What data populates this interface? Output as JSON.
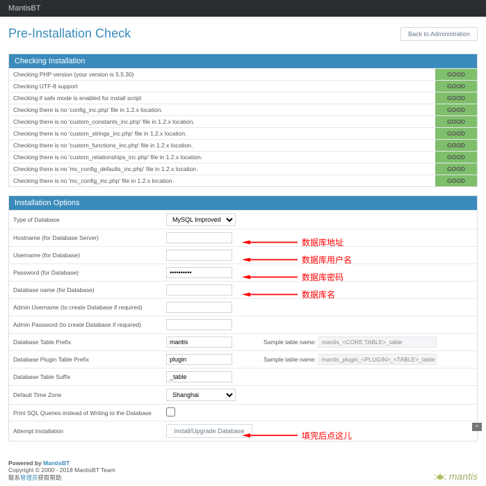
{
  "topbar": {
    "brand": "MantisBT"
  },
  "header": {
    "title": "Pre-Installation Check",
    "back_btn": "Back to Administration"
  },
  "check": {
    "heading": "Checking Installation",
    "rows": [
      {
        "label": "Checking PHP version (your version is 5.5.30)",
        "status": "GOOD"
      },
      {
        "label": "Checking UTF-8 support",
        "status": "GOOD"
      },
      {
        "label": "Checking if safe mode is enabled for install script",
        "status": "GOOD"
      },
      {
        "label": "Checking there is no 'config_inc.php' file in 1.2.x location.",
        "status": "GOOD"
      },
      {
        "label": "Checking there is no 'custom_constants_inc.php' file in 1.2.x location.",
        "status": "GOOD"
      },
      {
        "label": "Checking there is no 'custom_strings_inc.php' file in 1.2.x location.",
        "status": "GOOD"
      },
      {
        "label": "Checking there is no 'custom_functions_inc.php' file in 1.2.x location.",
        "status": "GOOD"
      },
      {
        "label": "Checking there is no 'custom_relationships_inc.php' file in 1.2.x location.",
        "status": "GOOD"
      },
      {
        "label": "Checking there is no 'mc_config_defaults_inc.php' file in 1.2.x location.",
        "status": "GOOD"
      },
      {
        "label": "Checking there is no 'mc_config_inc.php' file in 1.2.x location.",
        "status": "GOOD"
      }
    ]
  },
  "options": {
    "heading": "Installation Options",
    "db_type": {
      "label": "Type of Database",
      "value": "MySQL Improved"
    },
    "hostname": {
      "label": "Hostname (for Database Server)",
      "value": ""
    },
    "username": {
      "label": "Username (for Database)",
      "value": ""
    },
    "password": {
      "label": "Password (for Database)",
      "value": "••••••••••"
    },
    "dbname": {
      "label": "Database name (for Database)",
      "value": ""
    },
    "admin_user": {
      "label": "Admin Username (to create Database if required)",
      "value": ""
    },
    "admin_pass": {
      "label": "Admin Password (to create Database if required)",
      "value": ""
    },
    "prefix": {
      "label": "Database Table Prefix",
      "value": "mantis",
      "sample_label": "Sample table name:",
      "sample": "mantis_<CORE TABLE>_table"
    },
    "plugin_prefix": {
      "label": "Database Plugin Table Prefix",
      "value": "plugin",
      "sample_label": "Sample table name:",
      "sample": "mantis_plugin_<PLUGIN>_<TABLE>_table"
    },
    "suffix": {
      "label": "Database Table Suffix",
      "value": "_table"
    },
    "timezone": {
      "label": "Default Time Zone",
      "value": "Shanghai"
    },
    "print_sql": {
      "label": "Print SQL Queries instead of Writing to the Database"
    },
    "attempt": {
      "label": "Attempt Installation",
      "button": "Install/Upgrade Database"
    }
  },
  "annotations": {
    "hostname": "数据库地址",
    "username": "数据库用户名",
    "password": "数据库密码",
    "dbname": "数据库名",
    "attempt": "填完后点这儿"
  },
  "footer": {
    "powered_prefix": "Powered by ",
    "powered_link": "MantisBT",
    "copyright": "Copyright © 2000 - 2018 MantisBT Team",
    "contact_prefix": "联系",
    "contact_link": "管理员",
    "contact_suffix": "获取帮助",
    "logo_text": "mantis"
  }
}
